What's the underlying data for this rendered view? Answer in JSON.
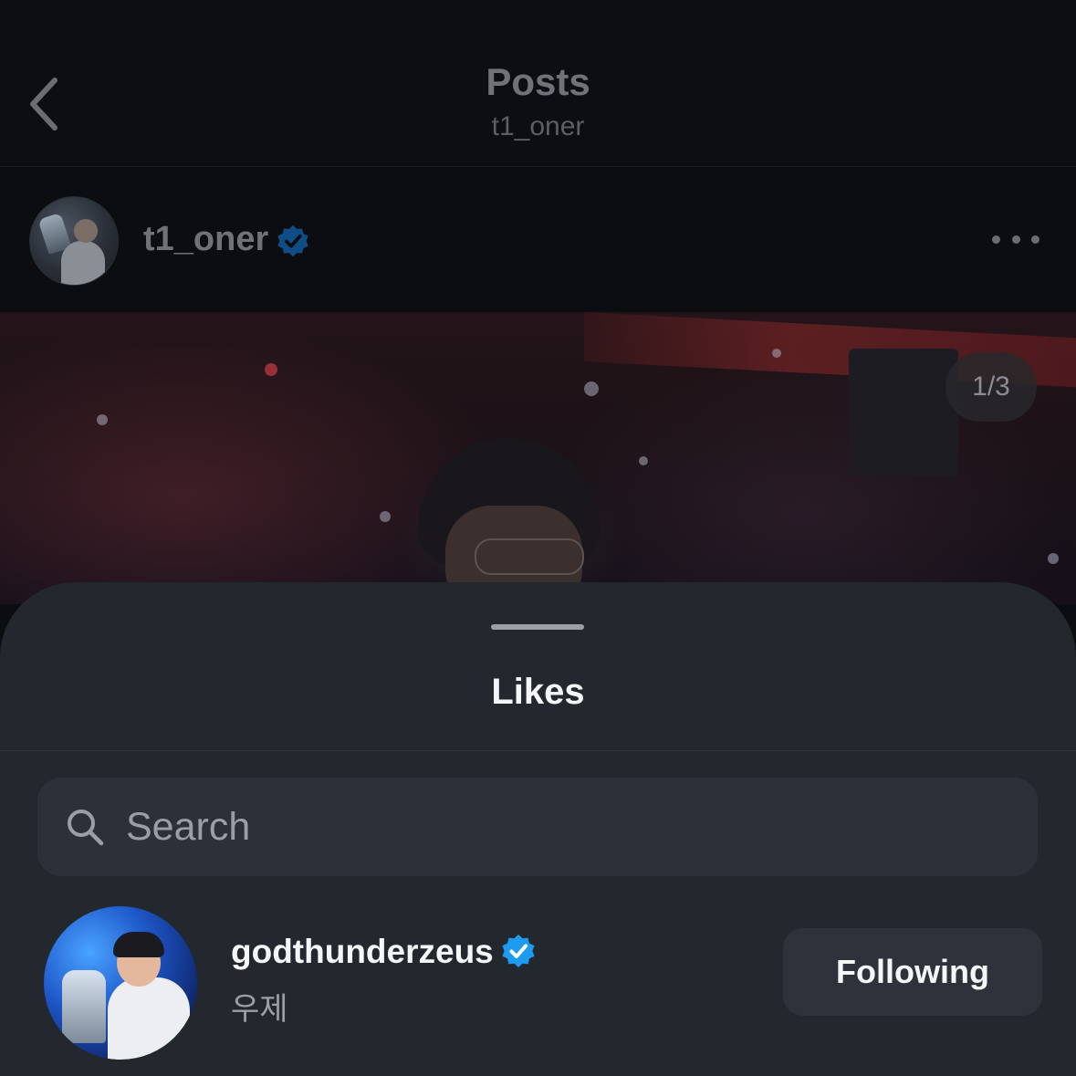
{
  "nav": {
    "title": "Posts",
    "subtitle": "t1_oner",
    "back_icon": "chevron-left-icon"
  },
  "post": {
    "author_username": "t1_oner",
    "author_verified": true,
    "more_icon": "more-horizontal-icon",
    "page_indicator": "1/3",
    "current_page": 1,
    "total_pages": 3
  },
  "likes_sheet": {
    "title": "Likes",
    "search": {
      "placeholder": "Search",
      "value": "",
      "icon": "search-icon"
    },
    "users": [
      {
        "username": "godthunderzeus",
        "display_name": "우제",
        "verified": true,
        "follow_label": "Following"
      }
    ]
  },
  "colors": {
    "sheet_background": "#23272e",
    "search_background": "#2c3038",
    "button_background": "#2e323a",
    "verified_blue": "#1d9bf0",
    "primary_text": "#f5f6f7",
    "secondary_text": "#9ba0a7"
  }
}
